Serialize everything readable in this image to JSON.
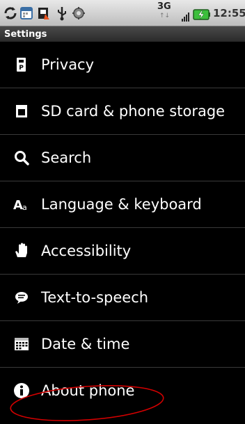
{
  "status_bar": {
    "network": "3G",
    "network_arrows": "↑↓",
    "time": "12:55",
    "icons": [
      "sync-icon",
      "calendar-icon",
      "flag-icon",
      "usb-icon",
      "debug-icon",
      "signal-icon",
      "battery-charging-icon"
    ]
  },
  "header": {
    "title": "Settings"
  },
  "settings": {
    "items": [
      {
        "label": "Privacy",
        "icon": "privacy-icon"
      },
      {
        "label": "SD card & phone storage",
        "icon": "sd-card-icon"
      },
      {
        "label": "Search",
        "icon": "search-icon"
      },
      {
        "label": "Language & keyboard",
        "icon": "language-icon"
      },
      {
        "label": "Accessibility",
        "icon": "accessibility-icon"
      },
      {
        "label": "Text-to-speech",
        "icon": "speech-icon"
      },
      {
        "label": "Date & time",
        "icon": "calendar-icon"
      },
      {
        "label": "About phone",
        "icon": "info-icon"
      }
    ]
  },
  "colors": {
    "background": "#000000",
    "text": "#ffffff",
    "annotation": "#d40000",
    "battery": "#3cbf3c"
  }
}
